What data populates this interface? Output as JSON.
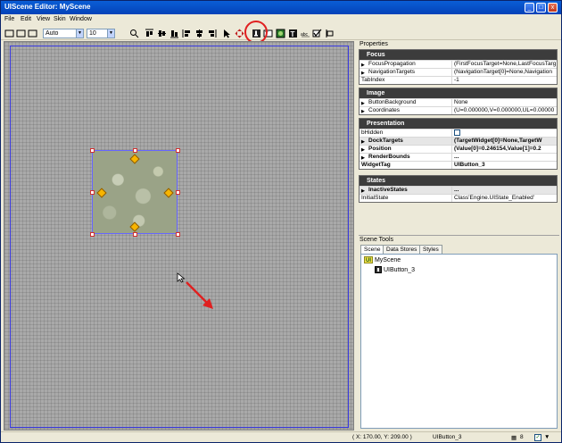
{
  "window": {
    "title": "UIScene Editor: MyScene",
    "min": "_",
    "max": "□",
    "close": "x"
  },
  "menu": [
    "File",
    "Edit",
    "View",
    "Skin",
    "Window"
  ],
  "toolbar": {
    "zoom_mode": "Auto",
    "grid_size": "10"
  },
  "properties": {
    "title": "Properties",
    "groups": [
      {
        "name": "Focus",
        "rows": [
          {
            "name": "FocusPropagation",
            "value": "(FirstFocusTarget=None,LastFocusTarg",
            "expand": true
          },
          {
            "name": "NavigationTargets",
            "value": "(NavigationTarget[0]=None,Navigation",
            "expand": true
          },
          {
            "name": "TabIndex",
            "value": "-1",
            "expand": false
          }
        ]
      },
      {
        "name": "Image",
        "rows": [
          {
            "name": "ButtonBackground",
            "value": "None",
            "expand": true
          },
          {
            "name": "Coordinates",
            "value": "(U=0.000000,V=0.000000,UL=0.00000",
            "expand": true
          }
        ]
      },
      {
        "name": "Presentation",
        "rows": [
          {
            "name": "bHidden",
            "value": "",
            "expand": false,
            "checkbox": true
          },
          {
            "name": "DockTargets",
            "value": "(TargetWidget[0]=None,TargetW",
            "expand": true,
            "bold": true
          },
          {
            "name": "Position",
            "value": "(Value[0]=0.246154,Value[1]=0.2",
            "expand": true,
            "bold": true
          },
          {
            "name": "RenderBounds",
            "value": "...",
            "expand": true,
            "bold": true
          },
          {
            "name": "WidgetTag",
            "value": "UIButton_3",
            "expand": false,
            "bold": true
          }
        ]
      },
      {
        "name": "States",
        "rows": [
          {
            "name": "InactiveStates",
            "value": "...",
            "expand": true,
            "bold": true
          },
          {
            "name": "InitialState",
            "value": "Class'Engine.UIState_Enabled'",
            "expand": false
          }
        ]
      }
    ]
  },
  "scene_tools": {
    "title": "Scene Tools",
    "tabs": [
      "Scene",
      "Data Stores",
      "Styles"
    ],
    "tree": {
      "root": "MyScene",
      "root_badge": "UI",
      "child": "UIButton_3"
    }
  },
  "status": {
    "coords": "( X: 170.00, Y: 209.00 )",
    "selection": "UIButton_3",
    "snap_value": "8"
  }
}
